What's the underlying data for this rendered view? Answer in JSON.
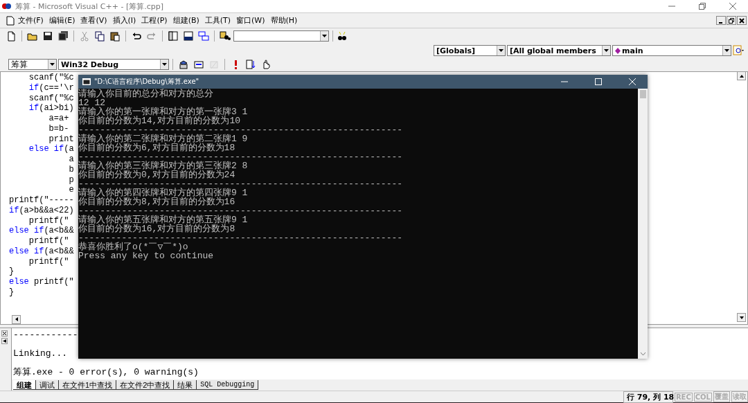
{
  "window": {
    "title": "筹算 - Microsoft Visual C++ - [筹算.cpp]"
  },
  "menu_bar": {
    "items": [
      "文件(F)",
      "编辑(E)",
      "查看(V)",
      "插入(I)",
      "工程(P)",
      "组建(B)",
      "工具(T)",
      "窗口(W)",
      "帮助(H)"
    ]
  },
  "toolbar": {
    "items": [
      {
        "kind": "new",
        "disabled": false
      },
      {
        "kind": "open",
        "disabled": false
      },
      {
        "kind": "save",
        "disabled": false
      },
      {
        "kind": "save-all",
        "disabled": false
      },
      {
        "kind": "cut",
        "disabled": true
      },
      {
        "kind": "copy",
        "disabled": false
      },
      {
        "kind": "paste",
        "disabled": false
      },
      {
        "kind": "undo",
        "disabled": false
      },
      {
        "kind": "redo",
        "disabled": true
      },
      {
        "kind": "workspace",
        "disabled": false
      },
      {
        "kind": "output",
        "disabled": false
      },
      {
        "kind": "windows",
        "disabled": false
      },
      {
        "kind": "find-files",
        "disabled": false
      }
    ]
  },
  "wizard_bar": {
    "class": "[Globals]",
    "filter": "[All global members",
    "member": "main"
  },
  "build_toolbar": {
    "project": "筹算",
    "configuration": "Win32 Debug",
    "items": [
      {
        "kind": "compile",
        "disabled": false
      },
      {
        "kind": "build",
        "disabled": false
      },
      {
        "kind": "stop",
        "disabled": true
      },
      {
        "kind": "execute",
        "disabled": false
      },
      {
        "kind": "go",
        "disabled": false
      },
      {
        "kind": "breakpoint",
        "disabled": false
      }
    ]
  },
  "editor": {
    "lines": [
      [
        {
          "text": "    scanf(\"%c",
          "kind": "code"
        }
      ],
      [
        {
          "text": "    if",
          "kind": "keyword"
        },
        {
          "text": "(c=='\\r",
          "kind": "code"
        }
      ],
      [
        {
          "text": "    scanf(\"%c",
          "kind": "code"
        }
      ],
      [
        {
          "text": "    if",
          "kind": "keyword"
        },
        {
          "text": "(ai>bi)",
          "kind": "code"
        }
      ],
      [
        {
          "text": "        a=a+",
          "kind": "code"
        }
      ],
      [
        {
          "text": "        b=b-",
          "kind": "code"
        }
      ],
      [
        {
          "text": "        print",
          "kind": "code"
        }
      ],
      [
        {
          "text": "    else if",
          "kind": "keyword"
        },
        {
          "text": "(a",
          "kind": "code"
        }
      ],
      [
        {
          "text": "            a",
          "kind": "code"
        }
      ],
      [
        {
          "text": "            b",
          "kind": "code"
        }
      ],
      [
        {
          "text": "            p",
          "kind": "code"
        }
      ],
      [
        {
          "text": "            e",
          "kind": "code"
        }
      ],
      [
        {
          "text": "printf(\"-----",
          "kind": "code"
        }
      ],
      [
        {
          "text": "if",
          "kind": "keyword"
        },
        {
          "text": "(a>b&&a<22)",
          "kind": "code"
        }
      ],
      [
        {
          "text": "    printf(\"",
          "kind": "code"
        }
      ],
      [
        {
          "text": "else if",
          "kind": "keyword"
        },
        {
          "text": "(a<b&&",
          "kind": "code"
        }
      ],
      [
        {
          "text": "    printf(\"",
          "kind": "code"
        }
      ],
      [
        {
          "text": "else if",
          "kind": "keyword"
        },
        {
          "text": "(a<b&&",
          "kind": "code"
        }
      ],
      [
        {
          "text": "    printf(\"",
          "kind": "code"
        }
      ],
      [
        {
          "text": "}",
          "kind": "code"
        }
      ],
      [
        {
          "text": "else",
          "kind": "keyword"
        },
        {
          "text": " printf(\"",
          "kind": "code"
        }
      ],
      [
        {
          "text": "}",
          "kind": "code"
        }
      ]
    ]
  },
  "console": {
    "title": "\"D:\\C语言程序\\Debug\\筹算.exe\"",
    "lines": [
      "请输入你目前的总分和对方的总分",
      "12 12",
      "请输入你的第一张牌和对方的第一张牌3 1",
      "你目前的分数为14,对方目前的分数为10",
      "------------------------------------------------------------",
      "请输入你的第二张牌和对方的第二张牌1 9",
      "你目前的分数为6,对方目前的分数为18",
      "------------------------------------------------------------",
      "请输入你的第三张牌和对方的第三张牌2 8",
      "你目前的分数为0,对方目前的分数为24",
      "------------------------------------------------------------",
      "请输入你的第四张牌和对方的第四张牌9 1",
      "你目前的分数为8,对方目前的分数为16",
      "------------------------------------------------------------",
      "请输入你的第五张牌和对方的第五张牌9 1",
      "你目前的分数为16,对方目前的分数为8",
      "------------------------------------------------------------",
      "恭喜你胜利了o(*￣▽￣*)o",
      "Press any key to continue"
    ]
  },
  "output": {
    "lines": [
      "------------",
      "Linking...",
      "筹算.exe - 0 error(s), 0 warning(s)"
    ],
    "tabs": [
      {
        "label": "组建",
        "selected": true
      },
      {
        "label": "调试",
        "selected": false
      },
      {
        "label": "在文件1中查找",
        "selected": false
      },
      {
        "label": "在文件2中查找",
        "selected": false
      },
      {
        "label": "结果",
        "selected": false
      },
      {
        "label": "SQL Debugging",
        "selected": false
      }
    ]
  },
  "status_bar": {
    "position": "行 79, 列 18",
    "indicators": [
      {
        "label": "REC",
        "disabled": true
      },
      {
        "label": "COL",
        "disabled": true
      },
      {
        "label": "覆盖",
        "disabled": true
      },
      {
        "label": "读取",
        "disabled": true
      }
    ]
  }
}
